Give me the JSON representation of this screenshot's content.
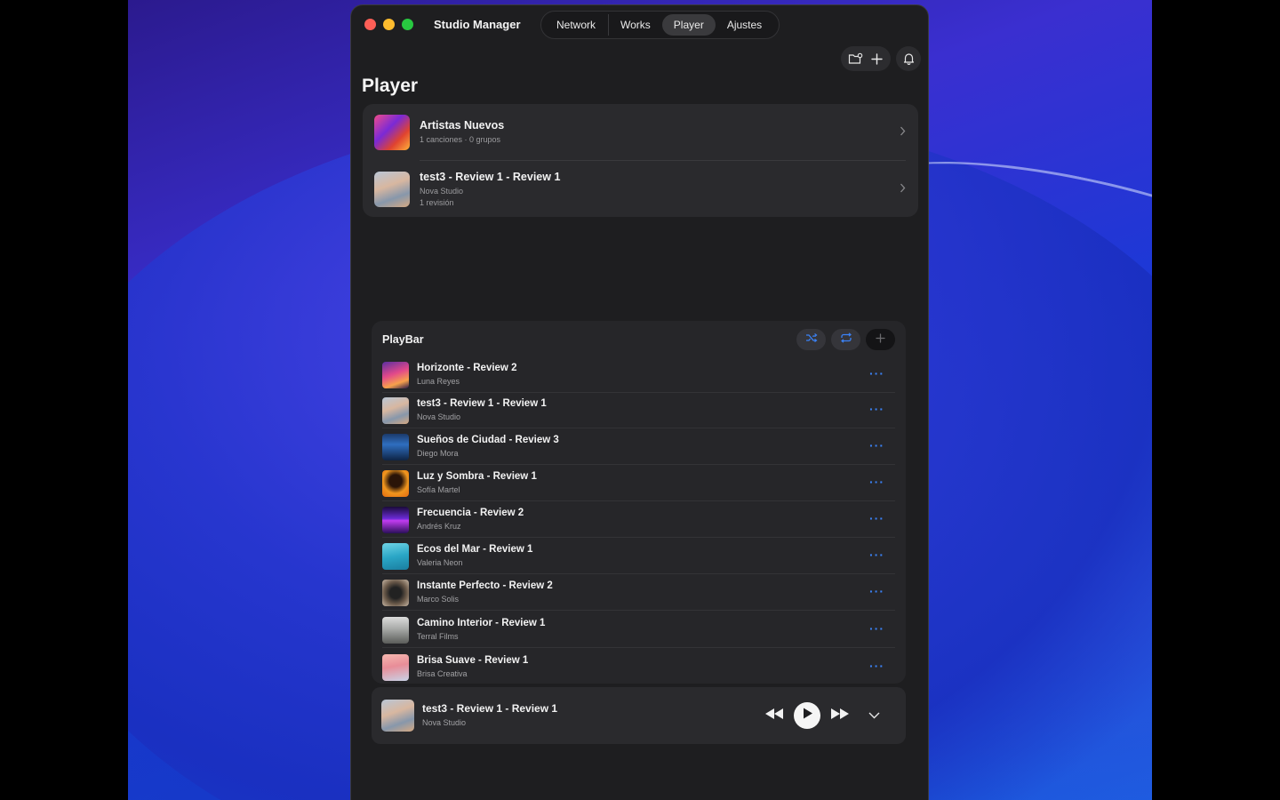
{
  "window": {
    "app_title": "Studio Manager",
    "tabs": [
      {
        "label": "Network",
        "active": false
      },
      {
        "label": "Works",
        "active": false
      },
      {
        "label": "Player",
        "active": true
      },
      {
        "label": "Ajustes",
        "active": false
      }
    ],
    "toolbar_icons": [
      "folder-badge-icon",
      "plus-icon",
      "bell-icon"
    ]
  },
  "page": {
    "title": "Player"
  },
  "library": [
    {
      "title": "Artistas Nuevos",
      "subtitle": "1 canciones · 0 grupos",
      "subtitle2": ""
    },
    {
      "title": "test3 - Review 1 - Review 1",
      "subtitle": "Nova Studio",
      "subtitle2": "1 revisión"
    }
  ],
  "playbar": {
    "title": "PlayBar",
    "actions": [
      "shuffle-icon",
      "repeat-icon",
      "add-icon"
    ],
    "tracks": [
      {
        "title": "Horizonte - Review 2",
        "artist": "Luna Reyes"
      },
      {
        "title": "test3 - Review 1 - Review 1",
        "artist": "Nova Studio"
      },
      {
        "title": "Sueños de Ciudad - Review 3",
        "artist": "Diego Mora"
      },
      {
        "title": "Luz y Sombra - Review 1",
        "artist": "Sofía Martel"
      },
      {
        "title": "Frecuencia - Review 2",
        "artist": "Andrés Kruz"
      },
      {
        "title": "Ecos del Mar - Review 1",
        "artist": "Valeria Neon"
      },
      {
        "title": "Instante Perfecto - Review 2",
        "artist": "Marco Solis"
      },
      {
        "title": "Camino Interior - Review 1",
        "artist": "Terral Films"
      },
      {
        "title": "Brisa Suave - Review 1",
        "artist": "Brisa Creativa"
      }
    ],
    "more_label": "···"
  },
  "now_playing": {
    "title": "test3 - Review 1 - Review 1",
    "artist": "Nova Studio"
  },
  "colors": {
    "accent": "#3b82f6",
    "window_bg": "#1e1e20",
    "card_bg": "#2a2a2d",
    "close": "#fe5f57",
    "minimize": "#febc2e",
    "zoom": "#28c840"
  }
}
